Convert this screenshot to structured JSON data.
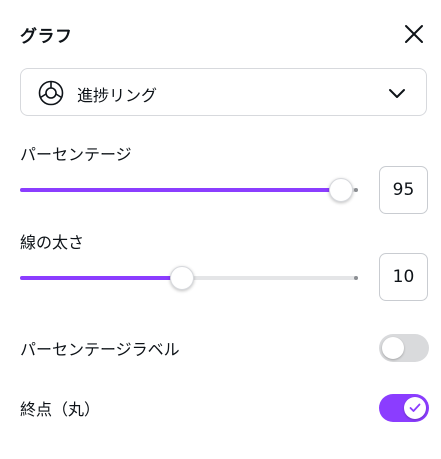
{
  "panel": {
    "title": "グラフ"
  },
  "chart_type": {
    "label": "進捗リング",
    "icon": "progress-ring-icon"
  },
  "percentage": {
    "label": "パーセンテージ",
    "value": "95",
    "fraction": 0.95
  },
  "line_width": {
    "label": "線の太さ",
    "value": "10",
    "fraction": 0.48
  },
  "toggles": {
    "percentage_label": {
      "label": "パーセンテージラベル",
      "on": false
    },
    "round_end": {
      "label": "終点（丸）",
      "on": true
    }
  },
  "colors": {
    "accent": "#8b3dff",
    "track": "#e4e5e7",
    "toggle_off": "#d9dadc"
  }
}
